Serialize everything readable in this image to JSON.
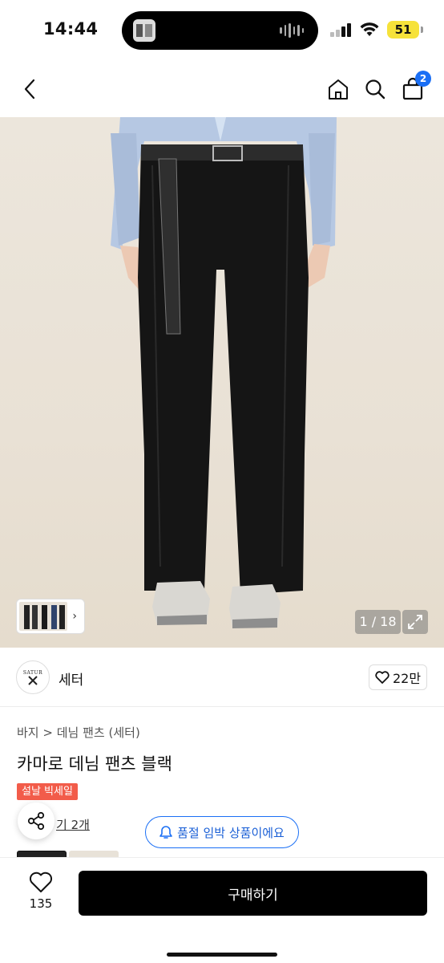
{
  "status_bar": {
    "time": "14:44",
    "battery": "51",
    "battery_color": "#f6e23a"
  },
  "nav": {
    "back_icon": "chevron-left-icon",
    "home_icon": "home-icon",
    "search_icon": "search-icon",
    "cart_icon": "bag-icon",
    "cart_count": "2",
    "badge_color": "#1a6ff5"
  },
  "gallery": {
    "counter": "1 / 18",
    "expand_icon": "expand-icon",
    "thumb_chevron": "›"
  },
  "store": {
    "logo_text": "SATUR",
    "name": "세터",
    "like_count": "22만"
  },
  "product": {
    "breadcrumb_category": "바지",
    "breadcrumb_separator": ">",
    "breadcrumb_sub": "데님 팬츠 (세터)",
    "title": "카마로 데님 팬츠 블랙",
    "sale_badge": "설날 빅세일",
    "sale_color": "#f25c4a",
    "review_link": "기 2개",
    "soldout_notice": "품절 임박 상품이에요"
  },
  "bottom": {
    "wish_count": "135",
    "buy_label": "구매하기"
  }
}
